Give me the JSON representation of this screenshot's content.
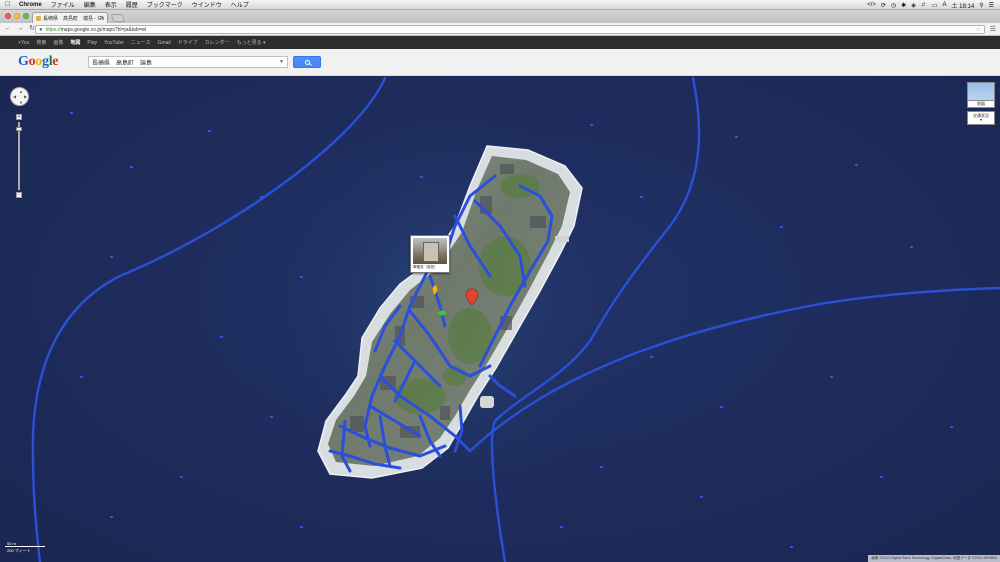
{
  "menubar": {
    "app_name": "Chrome",
    "items": [
      "ファイル",
      "編集",
      "表示",
      "履歴",
      "ブックマーク",
      "ウインドウ",
      "ヘルプ"
    ],
    "clock": "土 18:14"
  },
  "tab": {
    "title": "長崎県　高島町　端島 - Go"
  },
  "toolbar": {
    "url_scheme": "https://",
    "url_rest": "maps.google.co.jp/maps?hl=ja&tab=wl"
  },
  "gbar": {
    "items": [
      "+You",
      "検索",
      "画像",
      "地図",
      "Play",
      "YouTube",
      "ニュース",
      "Gmail",
      "ドライブ",
      "カレンダー",
      "もっと見る ▾"
    ],
    "selected_index": 3
  },
  "header": {
    "logo_letters": [
      "G",
      "o",
      "o",
      "g",
      "l",
      "e"
    ],
    "logo_colors": [
      "#1a5fd6",
      "#d93025",
      "#f2b300",
      "#1a5fd6",
      "#188038",
      "#d93025"
    ],
    "search_value": "長崎県　高島町　端島"
  },
  "map_controls": {
    "map_type_label": "地図",
    "traffic_label": "交通状況"
  },
  "streetview": {
    "caption": "軍艦島（端島）"
  },
  "scale": {
    "metric": "50 m",
    "imperial": "200 フィート"
  },
  "copyright": "画像 ©2013 Digital Earth Technology, DigitalGlobe, 地図データ ©2013 ZENRIN",
  "colors": {
    "water": "#1e2d5e",
    "streetview_line": "#2a50d8",
    "search_button": "#4787ed"
  }
}
